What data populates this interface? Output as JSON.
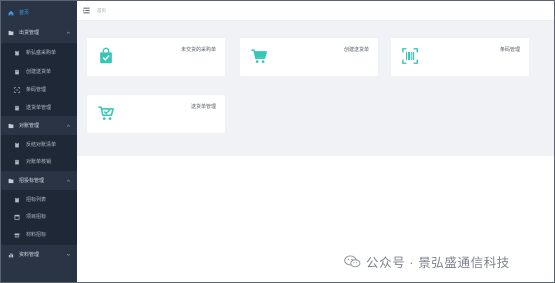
{
  "sidebar": {
    "home": {
      "label": "首页",
      "icon": "home-icon"
    },
    "groups": [
      {
        "label": "出货管理",
        "icon": "folder-icon",
        "items": [
          {
            "label": "新弘盛采购单",
            "icon": "clipboard-icon"
          },
          {
            "label": "创建送货单",
            "icon": "document-icon"
          },
          {
            "label": "条码管理",
            "icon": "scan-icon"
          },
          {
            "label": "送货单管理",
            "icon": "document-icon"
          }
        ]
      },
      {
        "label": "对账管理",
        "icon": "folder-icon",
        "items": [
          {
            "label": "反结对账清单",
            "icon": "clipboard-icon"
          },
          {
            "label": "对账单核销",
            "icon": "document-icon"
          }
        ]
      },
      {
        "label": "招投标管理",
        "icon": "folder-icon",
        "items": [
          {
            "label": "招标列表",
            "icon": "clipboard-icon"
          },
          {
            "label": "项目招标",
            "icon": "calendar-icon"
          },
          {
            "label": "材料招标",
            "icon": "gift-icon"
          }
        ]
      },
      {
        "label": "资料管理",
        "icon": "chart-icon",
        "items": []
      }
    ]
  },
  "topbar": {
    "breadcrumb": "首页"
  },
  "cards": [
    {
      "title": "未交货的采购单",
      "icon": "shopping-bag-check-icon"
    },
    {
      "title": "创建送货单",
      "icon": "shopping-cart-icon"
    },
    {
      "title": "条码管理",
      "icon": "barcode-scan-icon"
    },
    {
      "title": "送货单管理",
      "icon": "cart-check-icon"
    }
  ],
  "watermark": {
    "text": "公众号 · 景弘盛通信科技"
  },
  "colors": {
    "sidebar": "#2a3444",
    "sidebar_sub": "#1f2836",
    "active": "#3a9df4",
    "accent": "#36c6b8",
    "content_bg": "#f0f2f5"
  }
}
